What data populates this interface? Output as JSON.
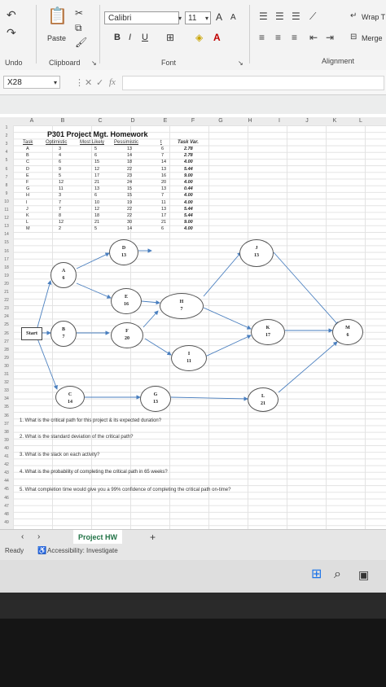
{
  "ribbon": {
    "undo_label": "Undo",
    "clipboard_label": "Clipboard",
    "paste_label": "Paste",
    "font_label": "Font",
    "alignment_label": "Alignment",
    "font_name": "Calibri",
    "font_size": "11",
    "bold": "B",
    "italic": "I",
    "underline": "U",
    "grow_font": "A",
    "shrink_font": "A",
    "wrap_text": "Wrap T",
    "merge": "Merge"
  },
  "formula_bar": {
    "name_box": "X28",
    "fx": "fx",
    "value": ""
  },
  "columns": [
    "A",
    "B",
    "C",
    "D",
    "E",
    "F",
    "G",
    "H",
    "I",
    "J",
    "K",
    "L"
  ],
  "rows": [
    "1",
    "2",
    "3",
    "4",
    "5",
    "6",
    "7",
    "8",
    "9",
    "10",
    "11",
    "12",
    "13",
    "14",
    "15",
    "16",
    "17",
    "18",
    "19",
    "20",
    "21",
    "22",
    "23",
    "24",
    "25",
    "26",
    "27",
    "28",
    "29",
    "30",
    "31",
    "32",
    "33",
    "34",
    "35",
    "36",
    "37",
    "38",
    "39",
    "40",
    "41",
    "42",
    "43",
    "44",
    "45",
    "46",
    "47",
    "48",
    "49"
  ],
  "sheet": {
    "title": "P301 Project Mgt. Homework",
    "headers": {
      "task": "Task",
      "optimistic": "Optimistic",
      "most_likely": "Most Likely",
      "pessimistic": "Pessimistic",
      "te": "t",
      "task_var": "Task Var."
    },
    "tasks": [
      {
        "task": "A",
        "opt": "3",
        "ml": "5",
        "pes": "13",
        "te": "6",
        "var": "2.78"
      },
      {
        "task": "B",
        "opt": "4",
        "ml": "6",
        "pes": "14",
        "te": "7",
        "var": "2.78"
      },
      {
        "task": "C",
        "opt": "6",
        "ml": "15",
        "pes": "18",
        "te": "14",
        "var": "4.00"
      },
      {
        "task": "D",
        "opt": "9",
        "ml": "12",
        "pes": "22",
        "te": "13",
        "var": "5.44"
      },
      {
        "task": "E",
        "opt": "5",
        "ml": "17",
        "pes": "23",
        "te": "16",
        "var": "9.00"
      },
      {
        "task": "F",
        "opt": "12",
        "ml": "21",
        "pes": "24",
        "te": "20",
        "var": "4.00"
      },
      {
        "task": "G",
        "opt": "11",
        "ml": "13",
        "pes": "15",
        "te": "13",
        "var": "0.44"
      },
      {
        "task": "H",
        "opt": "3",
        "ml": "6",
        "pes": "15",
        "te": "7",
        "var": "4.00"
      },
      {
        "task": "I",
        "opt": "7",
        "ml": "10",
        "pes": "19",
        "te": "11",
        "var": "4.00"
      },
      {
        "task": "J",
        "opt": "7",
        "ml": "12",
        "pes": "22",
        "te": "13",
        "var": "5.44"
      },
      {
        "task": "K",
        "opt": "8",
        "ml": "18",
        "pes": "22",
        "te": "17",
        "var": "5.44"
      },
      {
        "task": "L",
        "opt": "12",
        "ml": "21",
        "pes": "30",
        "te": "21",
        "var": "9.00"
      },
      {
        "task": "M",
        "opt": "2",
        "ml": "5",
        "pes": "14",
        "te": "6",
        "var": "4.00"
      }
    ]
  },
  "network": {
    "start_label": "Start",
    "nodes": [
      {
        "id": "A",
        "value": "6"
      },
      {
        "id": "B",
        "value": "7"
      },
      {
        "id": "C",
        "value": "14"
      },
      {
        "id": "D",
        "value": "13"
      },
      {
        "id": "E",
        "value": "16"
      },
      {
        "id": "F",
        "value": "20"
      },
      {
        "id": "G",
        "value": "13"
      },
      {
        "id": "H",
        "value": "7"
      },
      {
        "id": "I",
        "value": "11"
      },
      {
        "id": "J",
        "value": "13"
      },
      {
        "id": "K",
        "value": "17"
      },
      {
        "id": "L",
        "value": "21"
      },
      {
        "id": "M",
        "value": "6"
      }
    ]
  },
  "questions": [
    "1. What is the critical path for this project & its expected duration?",
    "2. What is the standard deviation of the critical path?",
    "3. What is the slack on each activity?",
    "4. What is the probability of completing the critical path in 65 weeks?",
    "5. What completion time would give you a 99% confidence of completing the critical path on-time?"
  ],
  "tabs": {
    "active_sheet": "Project HW",
    "add": "+"
  },
  "status": {
    "ready": "Ready",
    "accessibility": "Accessibility: Investigate"
  }
}
